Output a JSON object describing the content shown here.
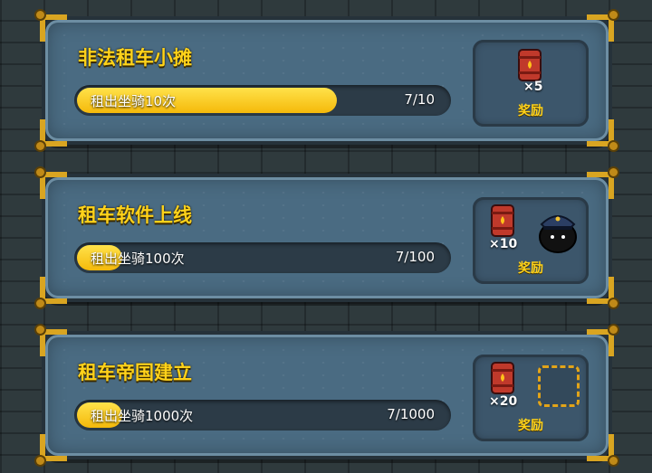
{
  "tasks": [
    {
      "title": "非法租车小摊",
      "progress_label": "租出坐骑10次",
      "progress_text": "7/10",
      "progress_fraction": 0.7,
      "reward_count": "×5",
      "reward_label": "奖励"
    },
    {
      "title": "租车软件上线",
      "progress_label": "租出坐骑100次",
      "progress_text": "7/100",
      "progress_fraction": 0.07,
      "reward_count": "×10",
      "reward_label": "奖励"
    },
    {
      "title": "租车帝国建立",
      "progress_label": "租出坐骑1000次",
      "progress_text": "7/1000",
      "progress_fraction": 0.007,
      "reward_count": "×20",
      "reward_label": "奖励"
    }
  ],
  "colors": {
    "accent_yellow": "#ffd21a",
    "panel_blue": "#4a6b82",
    "barrel_red": "#c0392b"
  },
  "icons": {
    "reward_item": "fuel-barrel-icon",
    "reward_pet": "black-blob-with-police-cap-icon",
    "empty_reward": "empty-reward-slot"
  }
}
